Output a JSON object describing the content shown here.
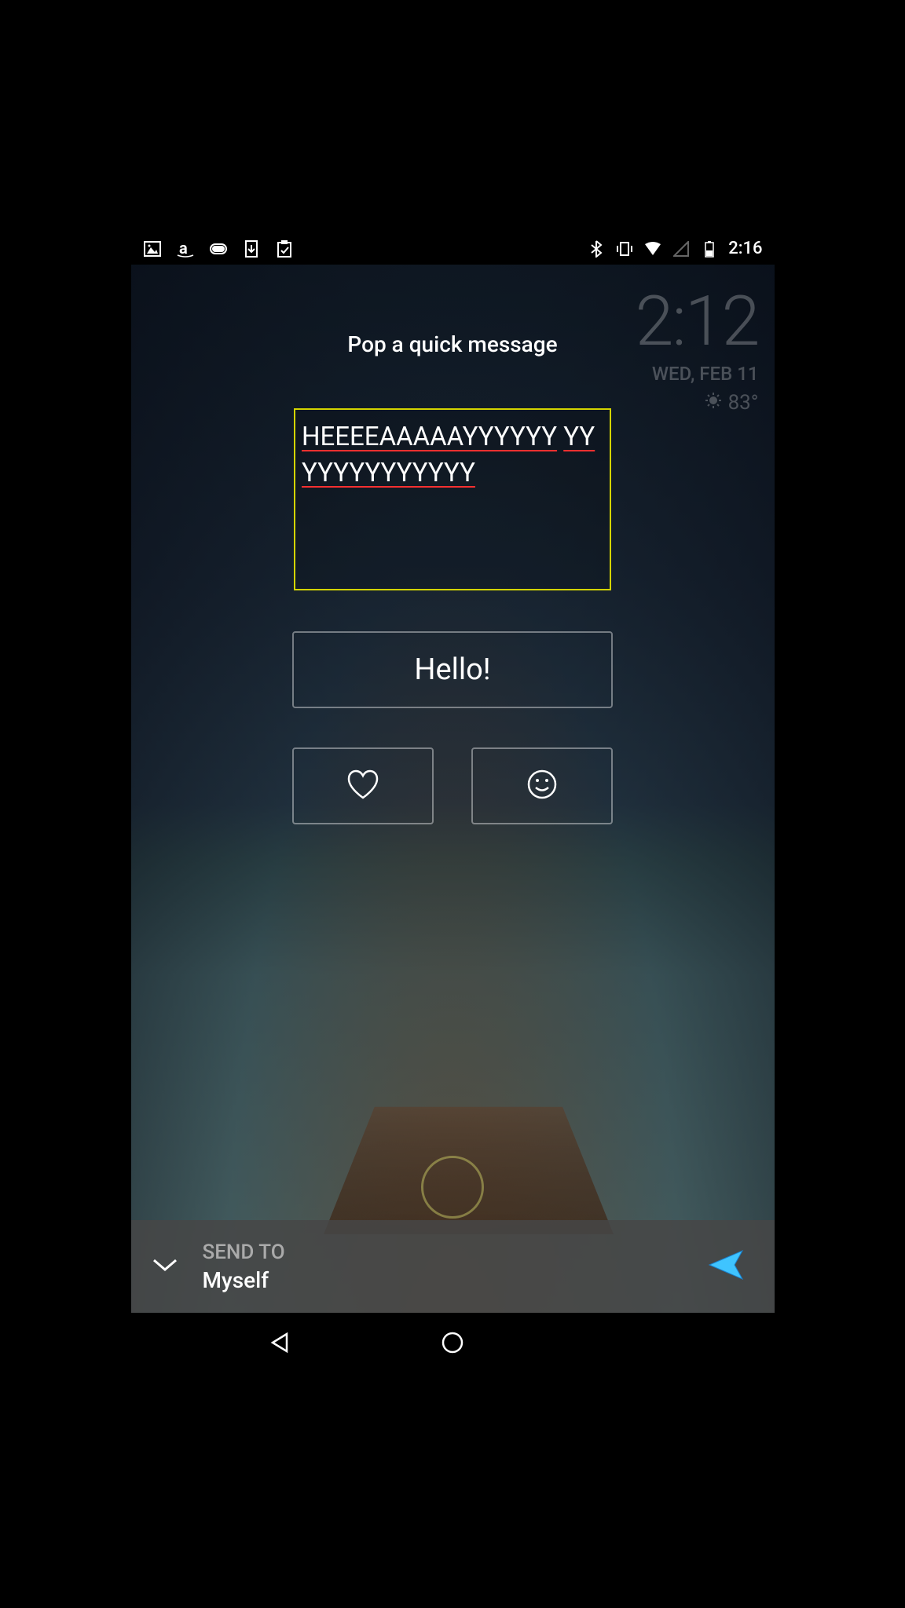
{
  "status_bar": {
    "time": "2:16",
    "icons": {
      "gallery": "gallery-icon",
      "amazon": "amazon-icon",
      "gameloft": "gameloft-icon",
      "download": "download-icon",
      "clipboard": "clipboard-icon",
      "bluetooth": "bluetooth-icon",
      "vibrate": "vibrate-icon",
      "wifi": "wifi-icon",
      "signal": "signal-icon",
      "battery": "battery-icon"
    }
  },
  "clock_widget": {
    "time": "2:12",
    "date": "WED, FEB 11",
    "temperature": "83°"
  },
  "title": "Pop a quick message",
  "message_input": {
    "line1": "HEEEEAAAAAYYYYYY",
    "line2": "YYYYYYYYYYYYY"
  },
  "quick_reply": {
    "hello": "Hello!"
  },
  "send_bar": {
    "label": "SEND TO",
    "recipient": "Myself"
  },
  "colors": {
    "input_border": "#d4d400",
    "spell_underline": "#ff3030",
    "send_arrow": "#3fc4ff"
  }
}
